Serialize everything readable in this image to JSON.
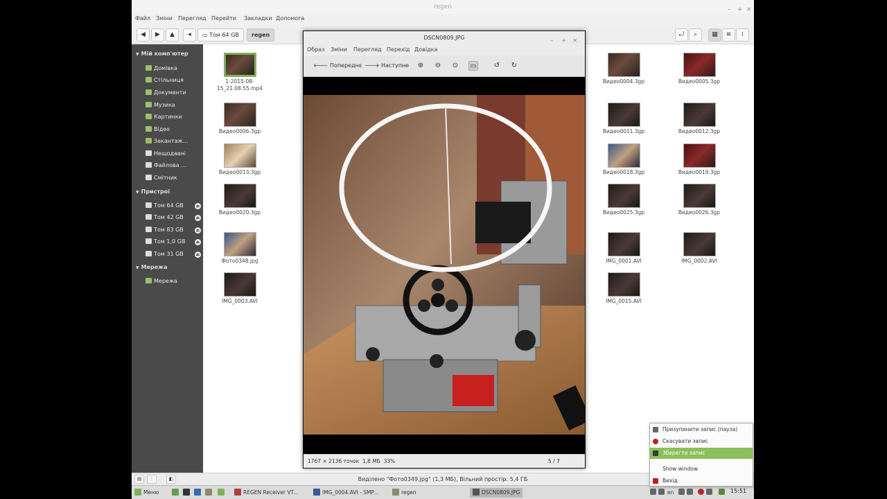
{
  "file_manager": {
    "title": "regen",
    "menu": [
      "Файл",
      "Зміни",
      "Перегляд",
      "Перейти",
      "Закладки",
      "Допомога"
    ],
    "breadcrumbs": [
      "Том 64 GB",
      "regen"
    ],
    "sidebar": {
      "sections": [
        {
          "title": "Мій комп'ютер",
          "items": [
            "Домівка",
            "Стільниця",
            "Документи",
            "Музика",
            "Картинки",
            "Відео",
            "Закантаж...",
            "Нещодавні",
            "Файлова ...",
            "Смітник"
          ]
        },
        {
          "title": "Пристрої",
          "items": [
            "Том 64 GB",
            "Том 42 GB",
            "Том 83 GB",
            "Том 1,0 GB",
            "Том 31 GB"
          ]
        },
        {
          "title": "Мережа",
          "items": [
            "Мережа"
          ]
        }
      ]
    },
    "files_left": [
      "1-2015-08-15_21.08.55.mp4",
      "Видео0006.3gp",
      "Видео0013.3gp",
      "Видео0020.3gp",
      "Фото0348.jpg",
      "IMG_0003.AVI"
    ],
    "files_right_a": [
      "Видео0004.3gp",
      "Видео0011.3gp",
      "Видео0018.3gp",
      "Видео0025.3gp",
      "IMG_0001.AVI",
      "IMG_0015.AVI"
    ],
    "files_right_b": [
      "Видео0005.3gp",
      "Видео0012.3gp",
      "Видео0019.3gp",
      "Видео0026.3gp",
      "IMG_0002.AVI"
    ],
    "status": "Виділено \"Фото0349.jpg\" (1,3 МБ), Вільний простір: 5,4 ГБ"
  },
  "viewer": {
    "title": "DSCN0809.JPG",
    "menu": [
      "Образ",
      "Зміни",
      "Перегляд",
      "Перехід",
      "Довідка"
    ],
    "prev_label": "Попереднє",
    "next_label": "Наступне",
    "info": "1767 × 2136 точок  1,8 МБ  33%",
    "position": "5 / 7"
  },
  "context_menu": {
    "items": [
      "Призупинити запис (пауза)",
      "Скасувати запис",
      "Зберегти запис",
      "Show window",
      "Вихід"
    ]
  },
  "taskbar": {
    "menu_label": "Меню",
    "windows": [
      "REGEN Receiver  VT...",
      "IMG_0004.AVI - SMP...",
      "regen",
      "DSCN0809.JPG"
    ],
    "lang": "en",
    "clock": "15:51"
  }
}
